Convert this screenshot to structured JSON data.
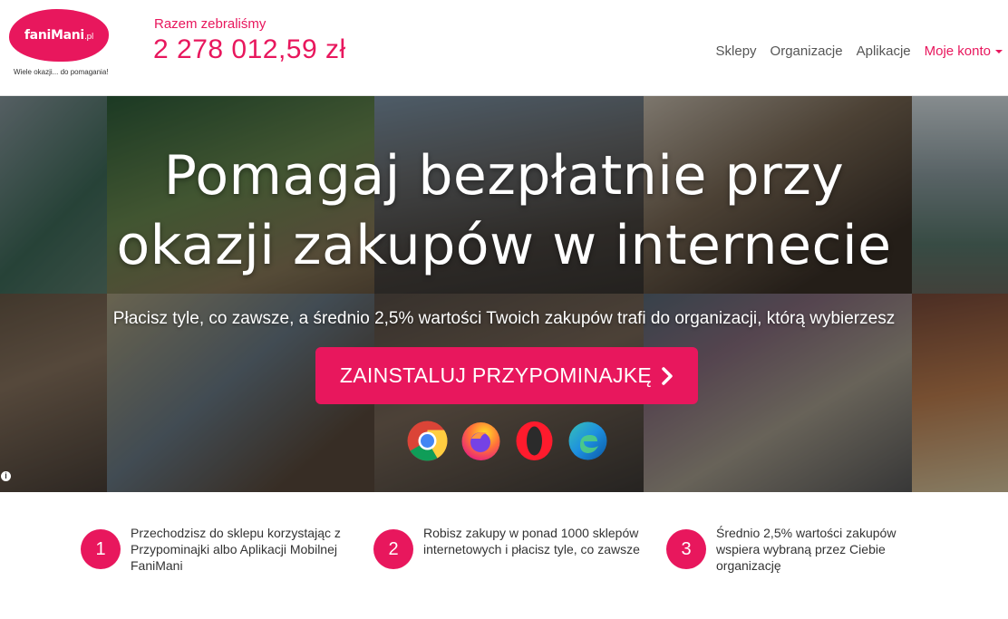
{
  "header": {
    "logo": {
      "brand": "faniMani",
      "suffix": ".pl"
    },
    "tagline": "Wiele okazji... do pomagania!",
    "raised_label": "Razem zebraliśmy",
    "raised_amount": "2 278 012,59 zł",
    "nav": [
      {
        "label": "Sklepy"
      },
      {
        "label": "Organizacje"
      },
      {
        "label": "Aplikacje"
      },
      {
        "label": "Moje konto"
      }
    ]
  },
  "hero": {
    "title_line1": "Pomagaj bezpłatnie przy",
    "title_line2": "okazji zakupów w internecie",
    "subtitle": "Płacisz tyle, co zawsze, a średnio 2,5% wartości Twoich zakupów trafi do organizacji, którą wybierzesz",
    "cta_label": "ZAINSTALUJ PRZYPOMINAJKĘ",
    "info_icon": "i",
    "browsers": [
      "chrome-icon",
      "firefox-icon",
      "opera-icon",
      "edge-icon"
    ]
  },
  "steps": [
    {
      "number": "1",
      "text": "Przechodzisz do sklepu korzystając z Przypominajki albo Aplikacji Mobilnej FaniMani"
    },
    {
      "number": "2",
      "text": "Robisz zakupy w ponad 1000 sklepów internetowych i płacisz tyle, co zawsze"
    },
    {
      "number": "3",
      "text": "Średnio 2,5% wartości zakupów wspiera wybraną przez Ciebie organizację"
    }
  ],
  "colors": {
    "accent": "#e8175d",
    "nav_text": "#555555"
  }
}
